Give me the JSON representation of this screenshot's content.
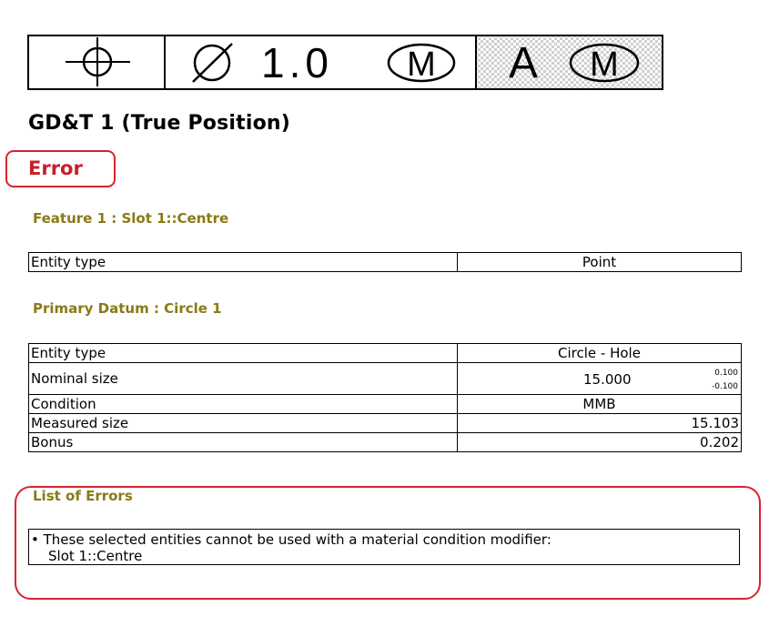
{
  "fcf": {
    "symbol_icon": "position-icon",
    "diameter_symbol": "⌀",
    "tolerance": "1.0",
    "tolerance_modifier": "M",
    "datum": "A",
    "datum_modifier": "M"
  },
  "title": "GD&T 1 (True Position)",
  "status": "Error",
  "feature": {
    "heading": "Feature 1 : Slot 1::Centre",
    "rows": [
      {
        "label": "Entity type",
        "value": "Point"
      }
    ]
  },
  "datum": {
    "heading": "Primary Datum : Circle 1",
    "entity_type": {
      "label": "Entity type",
      "value": "Circle - Hole"
    },
    "nominal": {
      "label": "Nominal size",
      "value": "15.000",
      "tol_upper": "0.100",
      "tol_lower": "-0.100"
    },
    "condition": {
      "label": "Condition",
      "value": "MMB"
    },
    "measured": {
      "label": "Measured size",
      "value": "15.103"
    },
    "bonus": {
      "label": "Bonus",
      "value": "0.202"
    }
  },
  "errors": {
    "heading": "List of Errors",
    "items": [
      {
        "line1": "• These selected entities cannot be used with a material condition modifier:",
        "line2": "Slot 1::Centre"
      }
    ]
  },
  "colors": {
    "error_red": "#c8202a",
    "heading_olive": "#8a7a14",
    "highlight_red": "#d8232e"
  }
}
